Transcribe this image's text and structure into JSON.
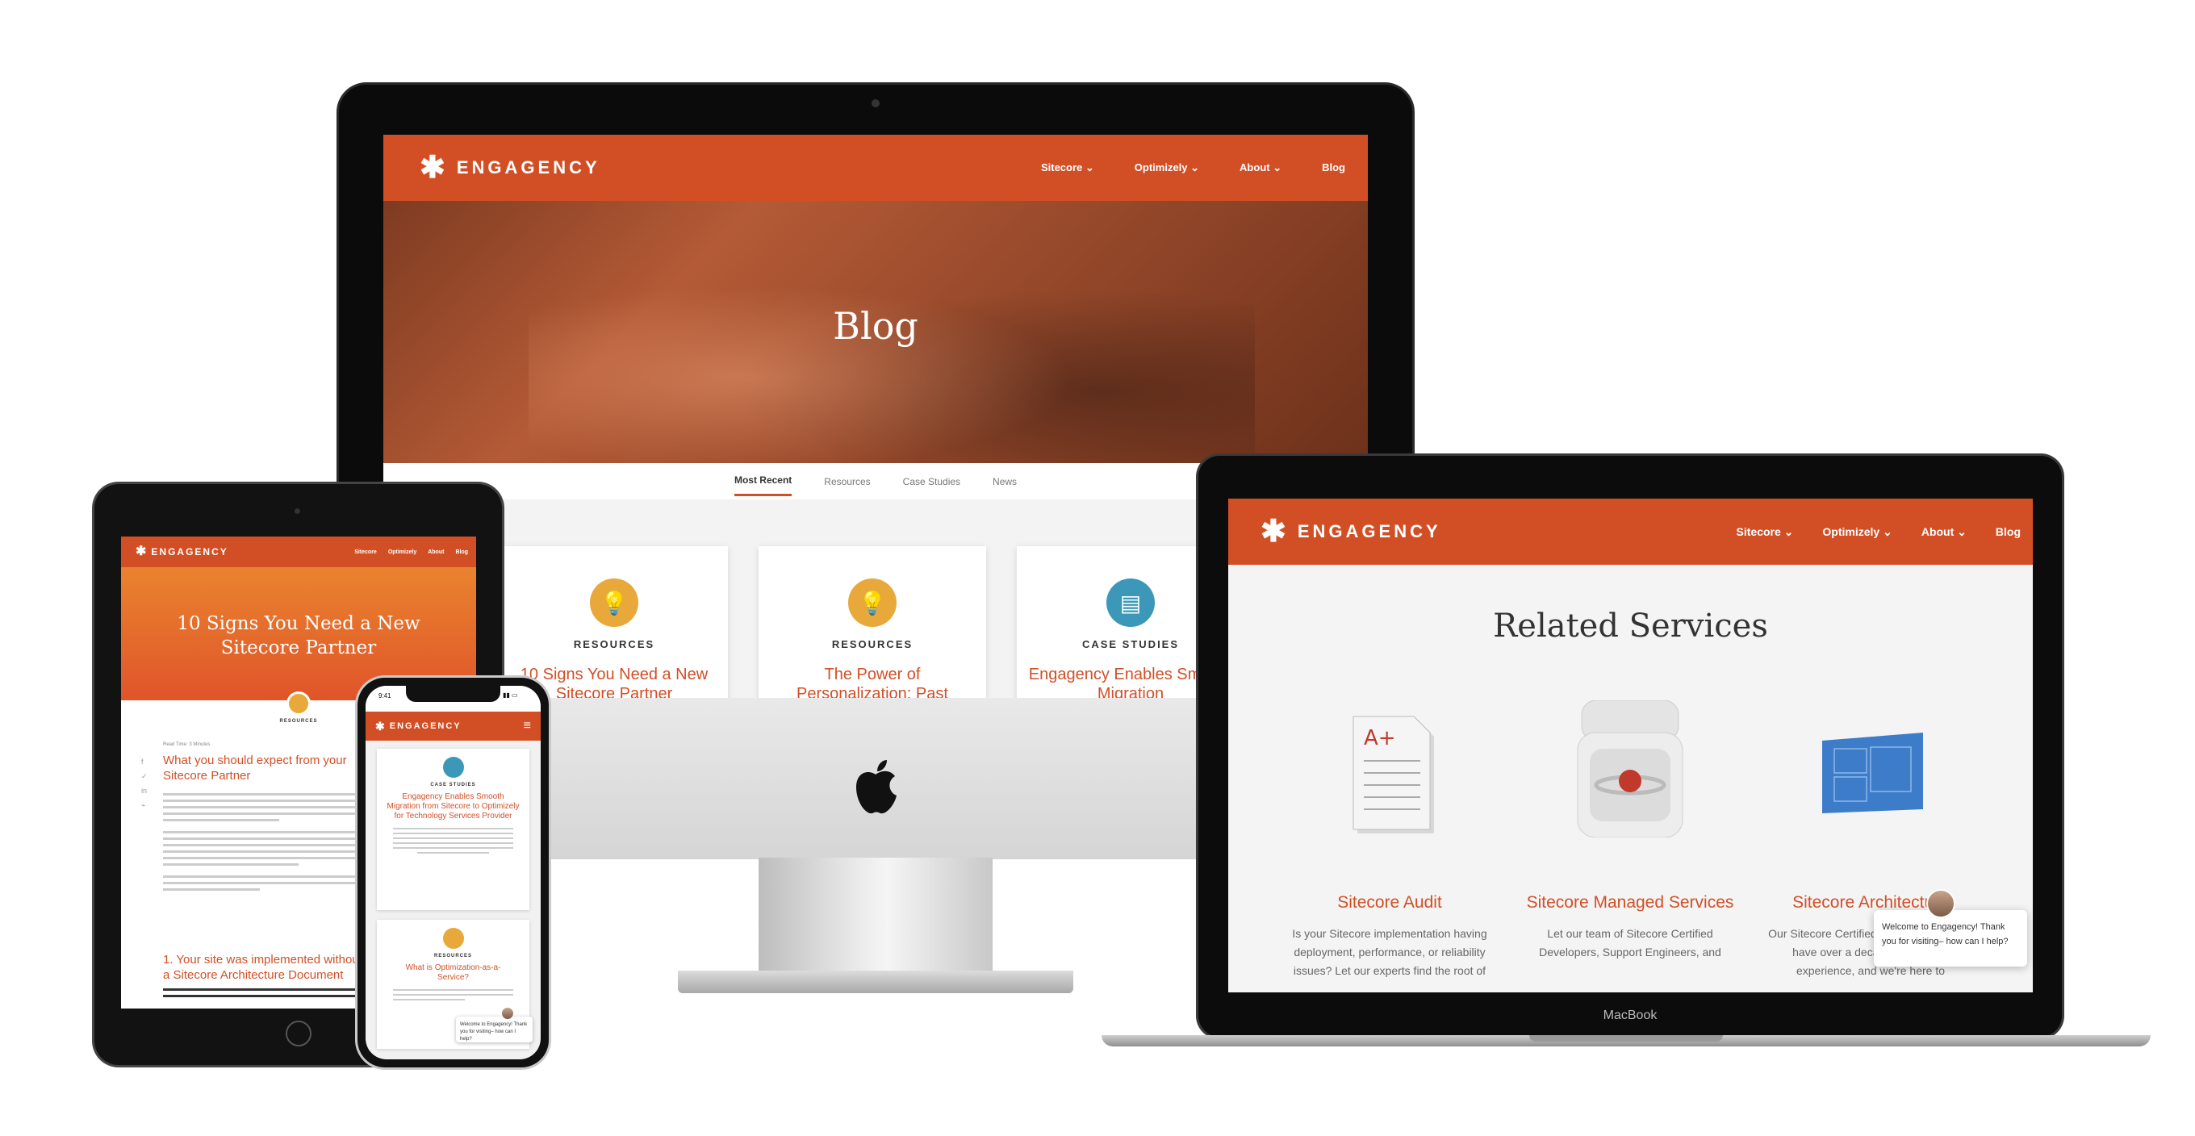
{
  "brand": {
    "name": "ENGAGENCY",
    "accent": "#d24f26",
    "teal": "#3bb3a6"
  },
  "nav": {
    "items": [
      "Sitecore",
      "Optimizely",
      "About",
      "Blog"
    ]
  },
  "imac": {
    "hero_title": "Blog",
    "tabs": [
      "Most Recent",
      "Resources",
      "Case Studies",
      "News"
    ],
    "cards": [
      {
        "category": "RESOURCES",
        "title": "10 Signs You Need a New Sitecore Partner",
        "icon": "lightbulb-icon"
      },
      {
        "category": "RESOURCES",
        "title": "The Power of Personalization: Past",
        "icon": "lightbulb-icon"
      },
      {
        "category": "CASE STUDIES",
        "title": "Engagency Enables Smooth Migration",
        "icon": "document-icon"
      }
    ]
  },
  "macbook": {
    "label": "MacBook",
    "section_title": "Related Services",
    "services": [
      {
        "name": "Sitecore Audit",
        "desc": "Is your Sitecore implementation having deployment, performance, or reliability issues? Let our experts find the root of"
      },
      {
        "name": "Sitecore Managed Services",
        "desc": "Let our team of Sitecore Certified Developers, Support Engineers, and"
      },
      {
        "name": "Sitecore Architecture",
        "desc": "Our Sitecore Certified Solution Architects have over a decade of Sitecore experience, and we're here to"
      }
    ],
    "chat_text": "Welcome to Engagency! Thank you for visiting– how can I help?"
  },
  "ipad": {
    "hero_title": "10 Signs You Need a New Sitecore Partner",
    "category": "RESOURCES",
    "read_time": "Read Time: 3 Minutes",
    "heading1": "What you should expect from your Sitecore Partner",
    "heading2": "1. Your site was implemented without a Sitecore Architecture Document"
  },
  "iphone": {
    "time": "9:41",
    "card1_category": "CASE STUDIES",
    "card1_title": "Engagency Enables Smooth Migration from Sitecore to Optimizely for Technology Services Provider",
    "card2_category": "RESOURCES",
    "card2_title": "What is Optimization-as-a-Service?",
    "chat_text": "Welcome to Engagency! Thank you for visiting– how can I help?"
  }
}
